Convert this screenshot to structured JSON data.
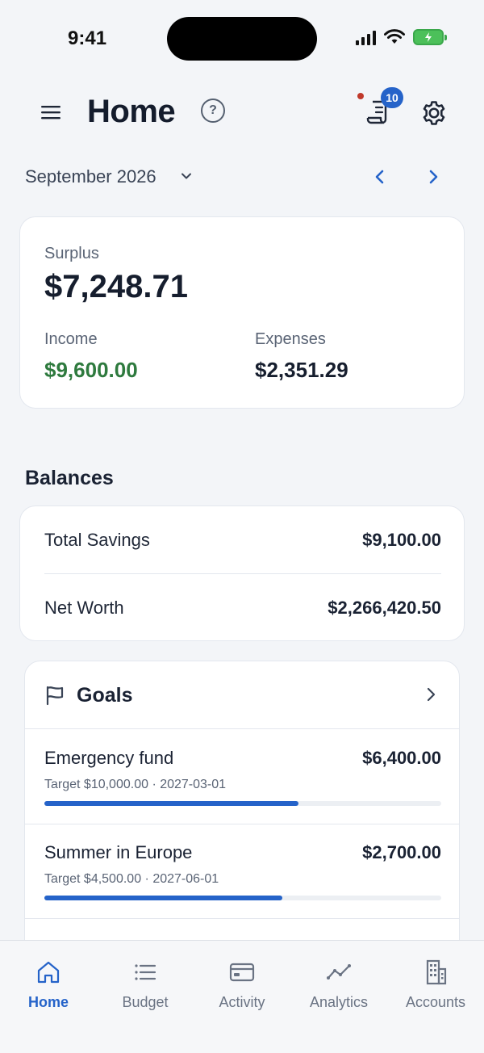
{
  "status_bar": {
    "time": "9:41"
  },
  "header": {
    "title": "Home",
    "help_glyph": "?",
    "receipt_badge_count": "10"
  },
  "month_selector": {
    "label": "September 2026"
  },
  "summary": {
    "surplus_label": "Surplus",
    "surplus_value": "$7,248.71",
    "income_label": "Income",
    "income_value": "$9,600.00",
    "expenses_label": "Expenses",
    "expenses_value": "$2,351.29"
  },
  "balances": {
    "title": "Balances",
    "rows": [
      {
        "label": "Total Savings",
        "value": "$9,100.00"
      },
      {
        "label": "Net Worth",
        "value": "$2,266,420.50"
      }
    ]
  },
  "goals": {
    "title": "Goals",
    "items": [
      {
        "name": "Emergency fund",
        "amount": "$6,400.00",
        "meta": "Target $10,000.00 · 2027-03-01",
        "progress": 0.64
      },
      {
        "name": "Summer in Europe",
        "amount": "$2,700.00",
        "meta": "Target $4,500.00 · 2027-06-01",
        "progress": 0.6
      }
    ]
  },
  "tabs": [
    {
      "label": "Home",
      "icon": "home-icon",
      "active": true
    },
    {
      "label": "Budget",
      "icon": "list-icon",
      "active": false
    },
    {
      "label": "Activity",
      "icon": "card-icon",
      "active": false
    },
    {
      "label": "Analytics",
      "icon": "trend-icon",
      "active": false
    },
    {
      "label": "Accounts",
      "icon": "building-icon",
      "active": false
    }
  ],
  "colors": {
    "accent": "#2563c9",
    "income_green": "#2e7a3e",
    "notification_dot": "#c0392b",
    "background": "#f3f5f8"
  }
}
